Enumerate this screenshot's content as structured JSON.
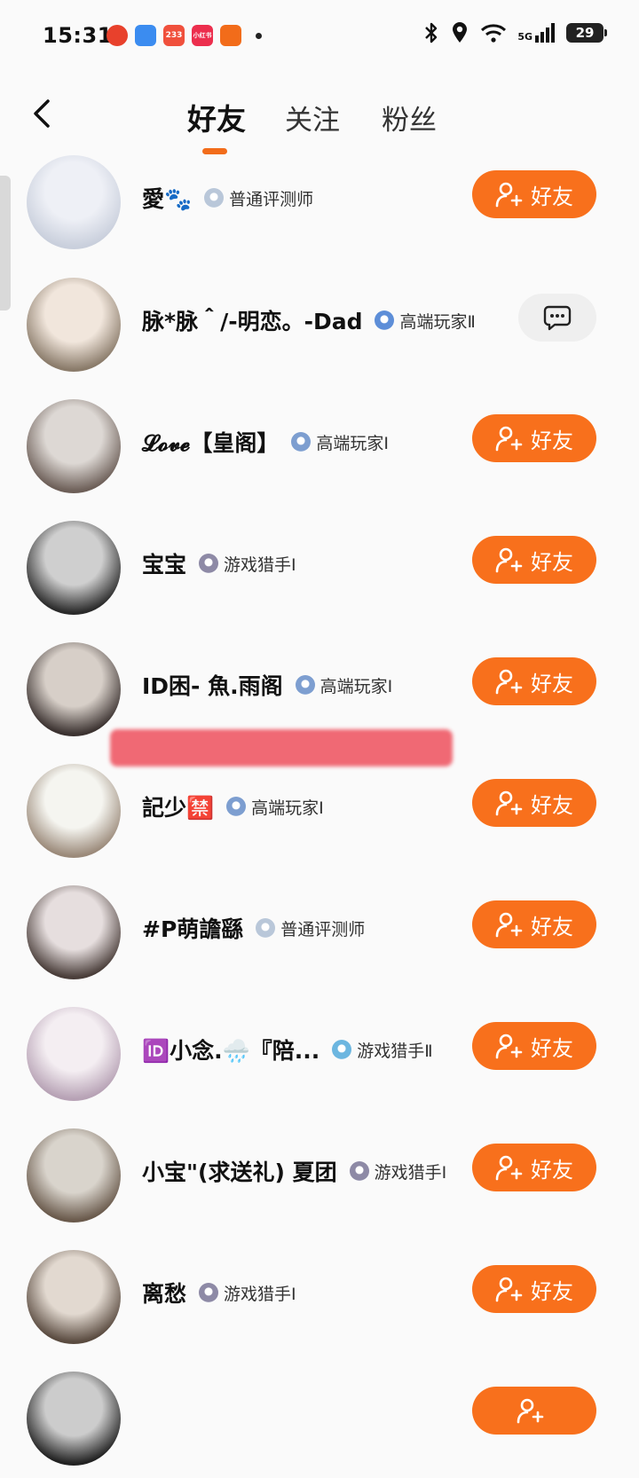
{
  "status_bar": {
    "time": "15:31",
    "app_icons": [
      {
        "name": "app-red-icon",
        "color": "#e8412c",
        "label": ""
      },
      {
        "name": "app-blue-icon",
        "color": "#3b8cf0",
        "label": ""
      },
      {
        "name": "app-233-icon",
        "color": "#f0503c",
        "label": "233"
      },
      {
        "name": "app-xiaohongshu-icon",
        "color": "#ec2e4d",
        "label": "小红书"
      },
      {
        "name": "app-orange-icon",
        "color": "#f26c1a",
        "label": ""
      }
    ],
    "network": "5G",
    "battery": "29"
  },
  "header": {
    "tabs": [
      {
        "label": "好友",
        "active": true
      },
      {
        "label": "关注",
        "active": false
      },
      {
        "label": "粉丝",
        "active": false
      }
    ],
    "accent": "#f26c1a"
  },
  "friends": [
    {
      "name": "愛🐾",
      "badge": "普通评测师",
      "action": "friend",
      "action_label": "好友"
    },
    {
      "name": "脉*脉＾/-明恋。-Dad",
      "badge": "高端玩家Ⅱ",
      "action": "message",
      "action_label": ""
    },
    {
      "name": "𝓛𝓸𝓿𝓮【皇阁】",
      "badge": "高端玩家Ⅰ",
      "action": "friend",
      "action_label": "好友"
    },
    {
      "name": "宝宝",
      "badge": "游戏猎手Ⅰ",
      "action": "friend",
      "action_label": "好友"
    },
    {
      "name": "ID困- 魚.雨阁",
      "badge": "高端玩家Ⅰ",
      "action": "friend",
      "action_label": "好友"
    },
    {
      "name": "記少🈲",
      "badge": "高端玩家Ⅰ",
      "action": "friend",
      "action_label": "好友"
    },
    {
      "name": "#P萌譫繇",
      "badge": "普通评测师",
      "action": "friend",
      "action_label": "好友"
    },
    {
      "name": "🆔小念.🌧️『陪...",
      "badge": "游戏猎手Ⅱ",
      "action": "friend",
      "action_label": "好友"
    },
    {
      "name": "小宝\"(求送礼) 夏团",
      "badge": "游戏猎手Ⅰ",
      "action": "friend",
      "action_label": "好友"
    },
    {
      "name": "离愁",
      "badge": "游戏猎手Ⅰ",
      "action": "friend",
      "action_label": "好友"
    },
    {
      "name": "",
      "badge": "",
      "action": "friend",
      "action_label": ""
    }
  ]
}
